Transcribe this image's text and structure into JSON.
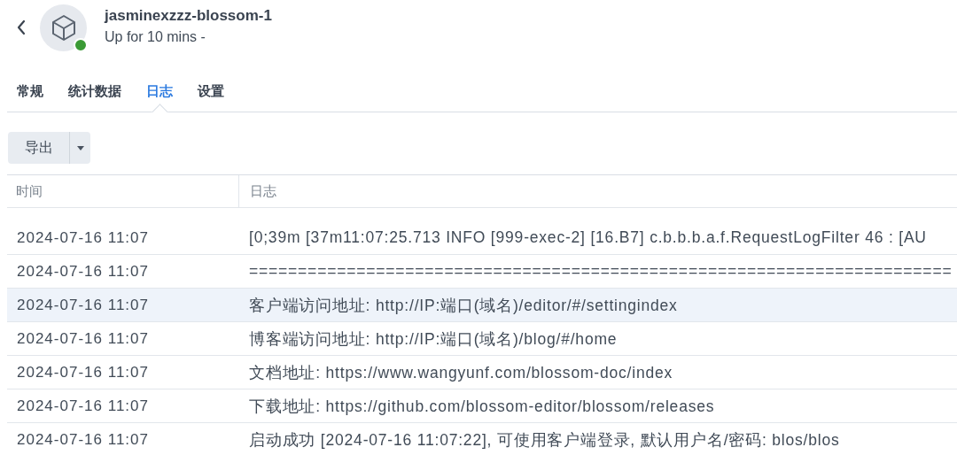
{
  "header": {
    "title": "jasminexzzz-blossom-1",
    "status": "Up for 10 mins -",
    "running": true
  },
  "tabs": [
    {
      "label": "常规",
      "selected": false
    },
    {
      "label": "统计数据",
      "selected": false
    },
    {
      "label": "日志",
      "selected": true
    },
    {
      "label": "设置",
      "selected": false
    }
  ],
  "toolbar": {
    "export_button": "导出"
  },
  "table": {
    "columns": [
      "时间",
      "日志"
    ],
    "rows": [
      {
        "time": "2024-07-16 11:07",
        "log": " [0;39m [37m11:07:25.713 INFO [999-exec-2] [16.B7] c.b.b.b.a.f.RequestLogFilter 46 : [AU",
        "selected": false
      },
      {
        "time": "2024-07-16 11:07",
        "log": "========================================================================",
        "selected": false
      },
      {
        "time": "2024-07-16 11:07",
        "log": "客户端访问地址: http://IP:端口(域名)/editor/#/settingindex",
        "selected": true
      },
      {
        "time": "2024-07-16 11:07",
        "log": "博客端访问地址: http://IP:端口(域名)/blog/#/home",
        "selected": false
      },
      {
        "time": "2024-07-16 11:07",
        "log": "文档地址: https://www.wangyunf.com/blossom-doc/index",
        "selected": false
      },
      {
        "time": "2024-07-16 11:07",
        "log": "下载地址: https://github.com/blossom-editor/blossom/releases",
        "selected": false
      },
      {
        "time": "2024-07-16 11:07",
        "log": "启动成功 [2024-07-16 11:07:22], 可使用客户端登录, 默认用户名/密码: blos/blos",
        "selected": false
      }
    ]
  }
}
